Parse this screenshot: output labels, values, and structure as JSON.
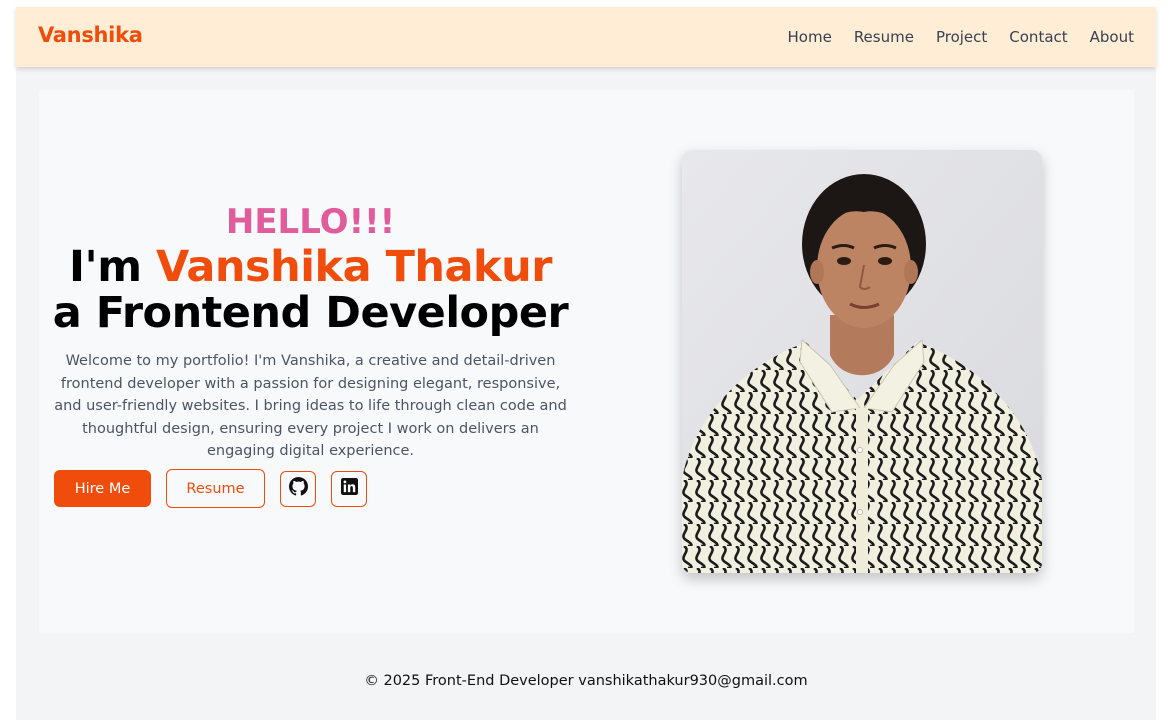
{
  "brand": "Vanshika",
  "nav": {
    "items": [
      {
        "label": "Home"
      },
      {
        "label": "Resume"
      },
      {
        "label": "Project"
      },
      {
        "label": "Contact"
      },
      {
        "label": "About"
      }
    ]
  },
  "hero": {
    "greeting": "HELLO!!!",
    "intro_prefix": "I'm ",
    "name": "Vanshika Thakur",
    "role_line": "a Frontend Developer",
    "description": "Welcome to my portfolio! I'm Vanshika, a creative and detail-driven frontend developer with a passion for designing elegant, responsive, and user-friendly websites. I bring ideas to life through clean code and thoughtful design, ensuring every project I work on delivers an engaging digital experience.",
    "hire_label": "Hire Me",
    "resume_label": "Resume"
  },
  "footer": {
    "text": "© 2025 Front-End Developer vanshikathakur930@gmail.com"
  },
  "colors": {
    "accent": "#f04c0b",
    "greeting": "#e05c9b",
    "navbar_bg": "#ffedd5",
    "page_bg": "#f3f4f6",
    "hero_bg": "#f8f9fb"
  },
  "icons": {
    "github": "github-icon",
    "linkedin": "linkedin-icon"
  }
}
